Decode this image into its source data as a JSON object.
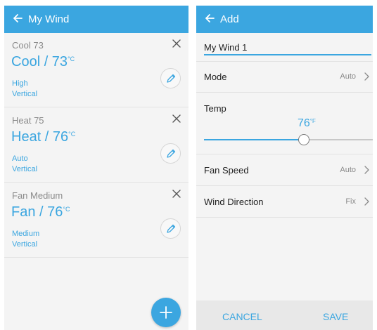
{
  "colors": {
    "accent": "#3ba6e0",
    "background": "#f4f4f4",
    "app_bar": "#3ba6e0"
  },
  "left": {
    "title": "My Wind",
    "cards": [
      {
        "name": "Cool 73",
        "mode": "Cool / 73",
        "unit": "°C",
        "fan": "High",
        "direction": "Vertical"
      },
      {
        "name": "Heat 75",
        "mode": "Heat / 76",
        "unit": "°C",
        "fan": "Auto",
        "direction": "Vertical"
      },
      {
        "name": "Fan Medium",
        "mode": "Fan / 76",
        "unit": "°C",
        "fan": "Medium",
        "direction": "Vertical"
      }
    ],
    "icons": {
      "back": "arrow-left-icon",
      "close": "close-icon",
      "edit": "pencil-icon",
      "add": "plus-icon"
    }
  },
  "right": {
    "title": "Add",
    "name_value": "My Wind 1",
    "mode": {
      "label": "Mode",
      "value": "Auto"
    },
    "temp": {
      "label": "Temp",
      "value": "76",
      "unit": "°F",
      "level_fraction": 0.59
    },
    "fan_speed": {
      "label": "Fan Speed",
      "value": "Auto"
    },
    "wind_direction": {
      "label": "Wind Direction",
      "value": "Fix"
    },
    "cancel_label": "CANCEL",
    "save_label": "SAVE"
  }
}
